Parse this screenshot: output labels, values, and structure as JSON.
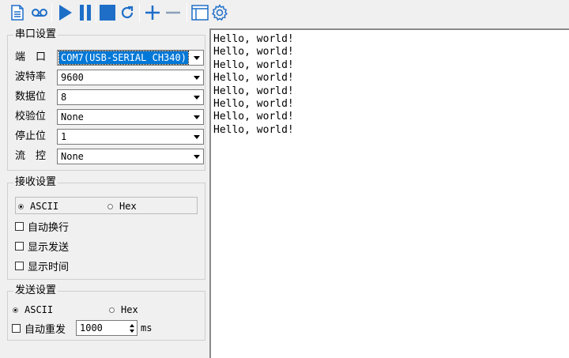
{
  "toolbar": {
    "buttons": [
      {
        "name": "new-document-icon"
      },
      {
        "name": "record-icon"
      },
      {
        "name": "play-icon"
      },
      {
        "name": "pause-icon"
      },
      {
        "name": "stop-icon"
      },
      {
        "name": "refresh-icon"
      },
      {
        "name": "add-icon"
      },
      {
        "name": "remove-icon"
      },
      {
        "name": "window-icon"
      },
      {
        "name": "settings-icon"
      }
    ],
    "accent_color": "#1e6ec8"
  },
  "serial_settings": {
    "title": "串口设置",
    "port_label": "端　口",
    "port_value": "COM7(USB-SERIAL CH340)",
    "baud_label": "波特率",
    "baud_value": "9600",
    "databits_label": "数据位",
    "databits_value": "8",
    "parity_label": "校验位",
    "parity_value": "None",
    "stopbits_label": "停止位",
    "stopbits_value": "1",
    "flow_label": "流　控",
    "flow_value": "None"
  },
  "receive_settings": {
    "title": "接收设置",
    "ascii_label": "ASCII",
    "hex_label": "Hex",
    "ascii_selected": true,
    "auto_wrap_label": "自动换行",
    "show_send_label": "显示发送",
    "show_time_label": "显示时间"
  },
  "send_settings": {
    "title": "发送设置",
    "ascii_label": "ASCII",
    "hex_label": "Hex",
    "ascii_selected": true,
    "auto_resend_label": "自动重发",
    "interval_value": "1000",
    "interval_unit": "ms"
  },
  "output": {
    "lines": [
      "Hello, world!",
      "Hello, world!",
      "Hello, world!",
      "Hello, world!",
      "Hello, world!",
      "Hello, world!",
      "Hello, world!",
      "Hello, world!"
    ]
  }
}
